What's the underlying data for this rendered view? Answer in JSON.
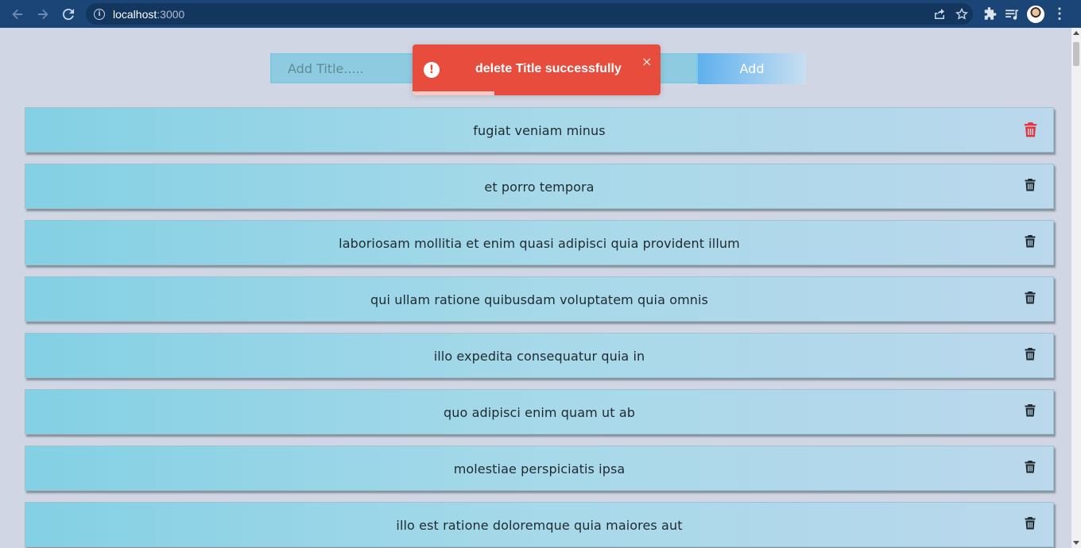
{
  "browser": {
    "url_host": "localhost",
    "url_port": ":3000"
  },
  "form": {
    "input_placeholder": "Add Title.....",
    "add_label": "Add"
  },
  "toast": {
    "icon_glyph": "!",
    "message": "delete Title successfully",
    "close_glyph": "×",
    "progress": 0.33,
    "color": "#e74c3c"
  },
  "todos": [
    {
      "title": "fugiat veniam minus",
      "trash_highlighted": true
    },
    {
      "title": "et porro tempora",
      "trash_highlighted": false
    },
    {
      "title": "laboriosam mollitia et enim quasi adipisci quia provident illum",
      "trash_highlighted": false
    },
    {
      "title": "qui ullam ratione quibusdam voluptatem quia omnis",
      "trash_highlighted": false
    },
    {
      "title": "illo expedita consequatur quia in",
      "trash_highlighted": false
    },
    {
      "title": "quo adipisci enim quam ut ab",
      "trash_highlighted": false
    },
    {
      "title": "molestiae perspiciatis ipsa",
      "trash_highlighted": false
    },
    {
      "title": "illo est ratione doloremque quia maiores aut",
      "trash_highlighted": false
    }
  ],
  "colors": {
    "page_bg": "#d0d6e3",
    "chrome_bg": "#1b4577",
    "trash_active": "#e5333f",
    "trash_default": "#1f2a30"
  }
}
